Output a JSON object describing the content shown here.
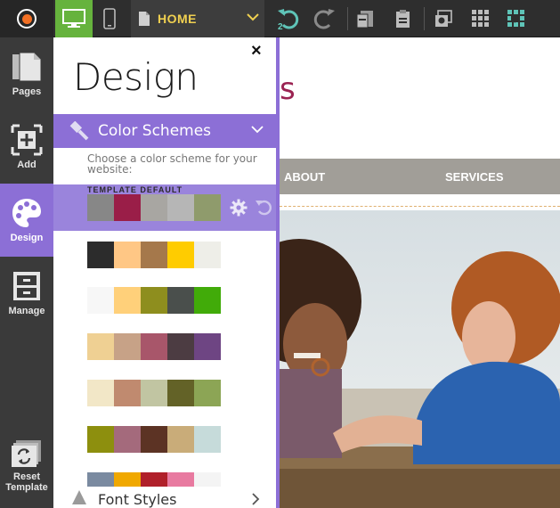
{
  "toolbar": {
    "page_name": "HOME",
    "undo_count": "2"
  },
  "left_nav": {
    "pages": "Pages",
    "add": "Add",
    "design": "Design",
    "manage": "Manage",
    "reset_line1": "Reset",
    "reset_line2": "Template"
  },
  "panel": {
    "title": "Design",
    "close": "×",
    "section_title": "Color Schemes",
    "instruction": "Choose a color scheme for your website:",
    "default_label": "TEMPLATE DEFAULT",
    "font_styles": "Font Styles"
  },
  "color_schemes": [
    [
      "#878787",
      "#9a1e48",
      "#a8a6a2",
      "#b6b6b6",
      "#8f9b6c"
    ],
    [
      "#2c2c2c",
      "#ffc785",
      "#a5784b",
      "#ffcc00",
      "#eeeee8"
    ],
    [
      "#f7f7f7",
      "#ffd07a",
      "#8e8e1e",
      "#4a4f4c",
      "#41ab09"
    ],
    [
      "#efd093",
      "#c7a287",
      "#a8566a",
      "#4c3c42",
      "#6e4583"
    ],
    [
      "#f2e7c7",
      "#c08a6f",
      "#c1c5a2",
      "#636227",
      "#8ca555"
    ],
    [
      "#8d8f0e",
      "#a46a7c",
      "#5c3324",
      "#c9ac79",
      "#c6dbda"
    ],
    [
      "#7a8aa0",
      "#f0a800",
      "#b0202a",
      "#e87aa0",
      "#f4f4f4"
    ]
  ],
  "site": {
    "title_fragment": "s",
    "nav_about": "ABOUT",
    "nav_services": "SERVICES"
  },
  "colors": {
    "accent": "#8c6fd6",
    "toolbar_bg": "#2e2e2e",
    "nav_bg": "#3a3a3a",
    "desktop_active": "#66b33d",
    "home_text": "#f0d050",
    "site_title": "#9b2352"
  }
}
